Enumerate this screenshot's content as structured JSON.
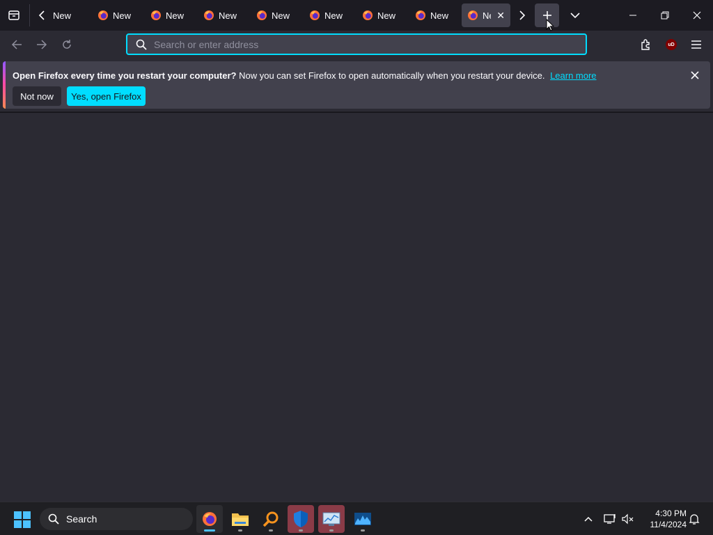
{
  "tabs": {
    "items": [
      {
        "label": "New",
        "partial": true
      },
      {
        "label": "New"
      },
      {
        "label": "New"
      },
      {
        "label": "New"
      },
      {
        "label": "New"
      },
      {
        "label": "New"
      },
      {
        "label": "New"
      },
      {
        "label": "New"
      },
      {
        "label": "Ne",
        "selected": true,
        "close": "✕"
      }
    ]
  },
  "urlbar": {
    "placeholder": "Search or enter address",
    "value": ""
  },
  "notification": {
    "title": "Open Firefox every time you restart your computer?",
    "message": "Now you can set Firefox to open automatically when you restart your device.",
    "link": "Learn more",
    "secondary_button": "Not now",
    "primary_button": "Yes, open Firefox"
  },
  "extension": {
    "ublock_label": "uD"
  },
  "taskbar": {
    "search_label": "Search",
    "time": "4:30 PM",
    "date": "11/4/2024"
  },
  "colors": {
    "accent": "#00ddff",
    "background": "#2b2a33",
    "tab_strip": "#1c1b22",
    "taskbar": "#1f1f23"
  }
}
